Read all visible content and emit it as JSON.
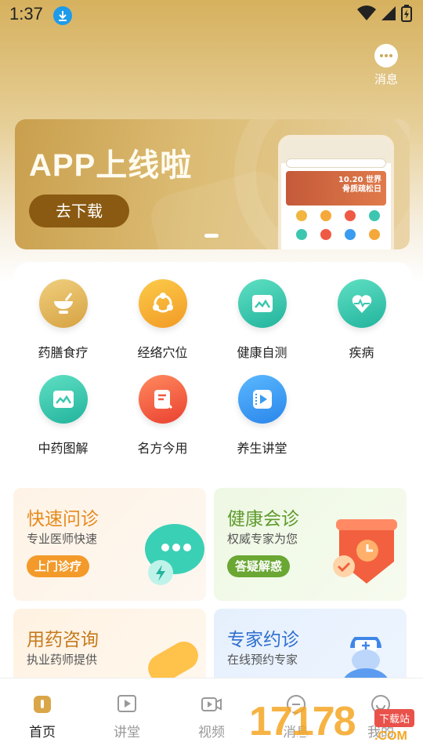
{
  "status_bar": {
    "time": "1:37"
  },
  "header": {
    "message_label": "消息"
  },
  "banner": {
    "title": "APP上线啦",
    "button_label": "去下载",
    "phone_img_text": "10.20 世界\n骨质疏松日"
  },
  "features": [
    {
      "label": "药膳食疗",
      "icon": "mortar-bowl-icon",
      "color": "#e6bb5e"
    },
    {
      "label": "经络穴位",
      "icon": "acupoint-ring-icon",
      "color": "#f6b336"
    },
    {
      "label": "健康自测",
      "icon": "health-monitor-icon",
      "color": "#3cc6b0"
    },
    {
      "label": "疾病",
      "icon": "heart-pulse-icon",
      "color": "#3cc6b0"
    },
    {
      "label": "中药图解",
      "icon": "herb-monitor-icon",
      "color": "#3cc6b0"
    },
    {
      "label": "名方今用",
      "icon": "prescription-note-icon",
      "color": "#f05a3c"
    },
    {
      "label": "养生讲堂",
      "icon": "video-book-icon",
      "color": "#3a9cf0"
    }
  ],
  "services": {
    "quick_consult": {
      "title": "快速问诊",
      "subtitle": "专业医师快速",
      "button": "上门诊疗"
    },
    "health_consult": {
      "title": "健康会诊",
      "subtitle": "权威专家为您",
      "button": "答疑解惑"
    },
    "medication": {
      "title": "用药咨询",
      "subtitle": "执业药师提供"
    },
    "expert": {
      "title": "专家约诊",
      "subtitle": "在线预约专家"
    }
  },
  "bottom_nav": [
    {
      "label": "首页",
      "icon": "home-icon",
      "active": true
    },
    {
      "label": "讲堂",
      "icon": "lecture-play-icon",
      "active": false
    },
    {
      "label": "视频",
      "icon": "video-camera-icon",
      "active": false
    },
    {
      "label": "消息",
      "icon": "message-icon",
      "active": false
    },
    {
      "label": "我的",
      "icon": "profile-icon",
      "active": false
    }
  ],
  "watermark": {
    "text": "17178",
    "badge": "下载站",
    "domain": ".COM"
  },
  "colors": {
    "accent": "#d3ab5a",
    "brown": "#8a5a12"
  }
}
